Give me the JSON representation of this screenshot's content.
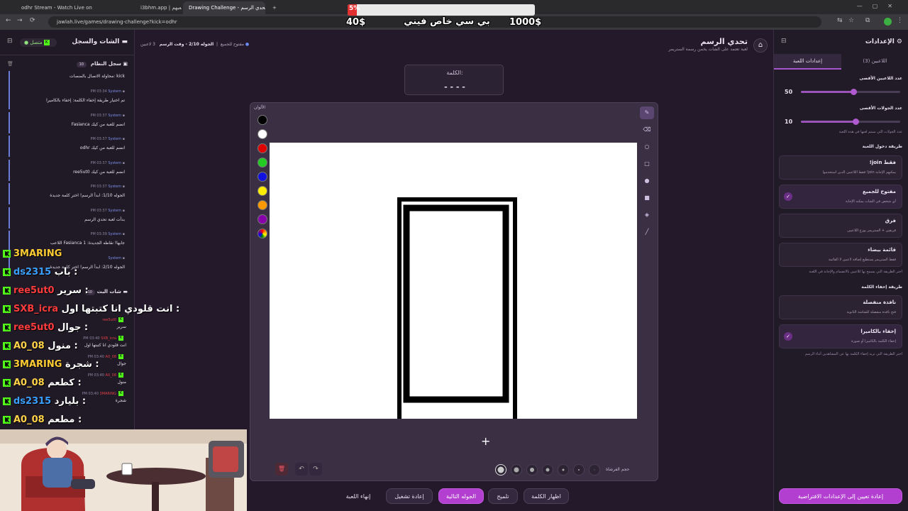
{
  "browser": {
    "tabs": [
      {
        "title": "odhr Stream - Watch Live on K",
        "active": false
      },
      {
        "title": "",
        "active": false
      },
      {
        "title": "i3bhm.app | لعبهم",
        "active": false
      },
      {
        "title": "Drawing Challenge - تحدي الرسم",
        "active": true
      }
    ],
    "url": "jawlah.live/games/drawing-challenge?kick=odhr",
    "new_tab": "+"
  },
  "overlay": {
    "progress_pct_label": "5%",
    "progress_fraction": 0.05,
    "left_amount": "40$",
    "right_amount": "1000$",
    "title": "بي سي خاص فيني"
  },
  "left_panel": {
    "title": "الشات والسجل",
    "status": "متصل",
    "system_log_title": "سجل النظام",
    "system_log_count": "10",
    "system_messages": [
      {
        "meta_name": "",
        "time": "",
        "text": "محاولة الاتصال بالمنصات: kick"
      },
      {
        "meta_name": "System",
        "time": "PM 03:34",
        "text": "تم اختيار طريقة إخفاء الكلمة: إخفاء بالكاميرا"
      },
      {
        "meta_name": "System",
        "time": "PM 03:37",
        "text": "Fasianca انضم للعبة من كيك"
      },
      {
        "meta_name": "System",
        "time": "PM 03:37",
        "text": "odhr انضم للعبة من كيك"
      },
      {
        "meta_name": "System",
        "time": "PM 03:37",
        "text": "ree5ut0 انضم للعبة من كيك"
      },
      {
        "meta_name": "System",
        "time": "PM 03:37",
        "text": "الجوله 1/10: ابدأ الرسم! اختر كلمة جديدة"
      },
      {
        "meta_name": "System",
        "time": "PM 03:37",
        "text": "بدأت لعبة تحدي الرسم"
      },
      {
        "meta_name": "System",
        "time": "PM 03:39",
        "text": "اللاعب Fasianca جابها! نقاطه الجديدة: 1"
      },
      {
        "meta_name": "System",
        "time": "",
        "text": "الجوله 2/10: ابدأ الرسم! اختر كلمة جديدة"
      }
    ],
    "chat_title": "شات البث",
    "chat_count": "10",
    "chat_messages": [
      {
        "user": "ree5ut0",
        "time": "",
        "text": "سرير"
      },
      {
        "user": "SXB_icra",
        "time": "PM 03:40",
        "text": "انت قلودي انا كتبتها اول"
      },
      {
        "user": "A0_08",
        "time": "PM 03:40",
        "text": "جوال"
      },
      {
        "user": "A0_08",
        "time": "PM 03:40",
        "text": "منول"
      },
      {
        "user": "3MARING",
        "time": "PM 03:40",
        "text": "شجرة"
      }
    ]
  },
  "stream_chat": [
    {
      "user": "3MARING",
      "text": "",
      "color": "#ffcc33"
    },
    {
      "user": "ds2315",
      "text": "باب :",
      "color": "#3aa0ff"
    },
    {
      "user": "ree5ut0",
      "text": "سرير :",
      "color": "#ff3b3b"
    },
    {
      "user": "SXB_icra",
      "text": "انت قلودي انا كتبتها اول :",
      "color": "#ff3b3b"
    },
    {
      "user": "ree5ut0",
      "text": "جوال :",
      "color": "#ff3b3b"
    },
    {
      "user": "A0_08",
      "text": "منول :",
      "color": "#ffd24a"
    },
    {
      "user": "3MARING",
      "text": "شجرة :",
      "color": "#ffcc33"
    },
    {
      "user": "A0_08",
      "text": "كطعم :",
      "color": "#ffd24a"
    },
    {
      "user": "ds2315",
      "text": "بليارد :",
      "color": "#3aa0ff"
    },
    {
      "user": "A0_08",
      "text": "مطعم :",
      "color": "#ffd24a"
    }
  ],
  "header": {
    "title": "تحدي الرسم",
    "subtitle": "لعبة تعتمد على الشات يخمن رسمة الستريمر",
    "players": "3 لاعبين",
    "round": "الجوله 2/10 - وقت الرسم",
    "mode": "مفتوح للجميع"
  },
  "word_box": {
    "label": "الكلمة:",
    "hint": "- - - -"
  },
  "canvas": {
    "colors_label": "الألوان",
    "colors": [
      "#000000",
      "#ffffff",
      "#e00000",
      "#22cc22",
      "#1010e0",
      "#ffee00",
      "#ff9900",
      "#8800aa"
    ],
    "brush_size_label": "حجم الفرشاة",
    "cursor": "+"
  },
  "actions": {
    "end_game": "إنهاء اللعبة",
    "restart": "إعادة تشغيل",
    "next_round": "الجوله التالية",
    "hint": "تلميح",
    "reveal_word": "اظهار الكلمة"
  },
  "right_panel": {
    "title": "الإعدادات",
    "tabs": [
      "إعدادات اللعبة",
      "اللاعبين (3)"
    ],
    "max_players_label": "عدد اللاعبين الأقصى",
    "max_players": "50",
    "max_players_fraction": 0.53,
    "max_rounds_label": "عدد الجولات الأقصى",
    "max_rounds": "10",
    "max_rounds_fraction": 0.55,
    "rounds_note": "عدد الجولات التي سيتم لعبها في هذه اللعبة",
    "join_section": "طريقة دخول اللعبة",
    "join_options": [
      {
        "title": "!join فقط",
        "desc": "فقط اللاعبين الذين استخدموا !join يمكنهم الإجابة",
        "checked": false
      },
      {
        "title": "مفتوح للجميع",
        "desc": "أي شخص في الشات يمكنه الإجابة",
        "checked": true
      },
      {
        "title": "فرق",
        "desc": "فريقين + الستريمر يوزع اللاعبين",
        "checked": false
      },
      {
        "title": "قائمة بيضاء",
        "desc": "فقط الستريمر يستطيع إضافة لاعبين لا القائمة",
        "checked": false
      }
    ],
    "join_note": "اختر الطريقة التي يسمح بها للاعبين بالانضمام والإجابة في اللعبة",
    "hide_section": "طريقة إخفاء الكلمة",
    "hide_options": [
      {
        "title": "نافذة منفصلة",
        "desc": "فتح نافذة منفصلة للشاشة الثانوية",
        "checked": false
      },
      {
        "title": "إخفاء بالكاميرا",
        "desc": "إخفاء الكلمة بالكاميرا أو صورة",
        "checked": true
      }
    ],
    "hide_note": "اختر الطريقة التي تريد إخفاء الكلمة بها عن المشاهدين أثناء الرسم",
    "reset_button": "إعادة تعيين إلى الإعدادات الافتراضية"
  }
}
